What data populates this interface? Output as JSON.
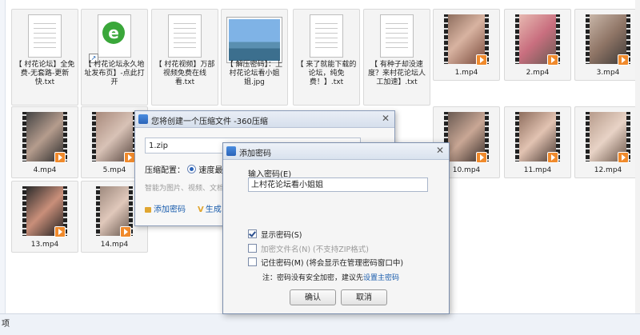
{
  "files": [
    {
      "name": "【 村花论坛】全免费-无套路-更新快.txt",
      "kind": "text"
    },
    {
      "name": "【 村花论坛永久地址发布页】-点此打开",
      "kind": "shortcut"
    },
    {
      "name": "【 村花视频】万部视频免费在线看.txt",
      "kind": "text"
    },
    {
      "name": "【 解压密码】：上村花论坛看小姐姐.jpg",
      "kind": "image"
    },
    {
      "name": "【 来了就能下载的论坛，纯免费！】.txt",
      "kind": "text"
    },
    {
      "name": "【 有种子却没速度？来村花论坛人工加速】.txt",
      "kind": "text"
    },
    {
      "name": "1.mp4",
      "kind": "video"
    },
    {
      "name": "2.mp4",
      "kind": "video"
    },
    {
      "name": "3.mp4",
      "kind": "video"
    },
    {
      "name": "4.mp4",
      "kind": "video"
    },
    {
      "name": "5.mp4",
      "kind": "video"
    },
    {
      "name": "10.mp4",
      "kind": "video"
    },
    {
      "name": "11.mp4",
      "kind": "video"
    },
    {
      "name": "12.mp4",
      "kind": "video"
    },
    {
      "name": "13.mp4",
      "kind": "video"
    },
    {
      "name": "14.mp4",
      "kind": "video"
    }
  ],
  "status_bar": {
    "text": "项"
  },
  "compress_dialog": {
    "title": "您将创建一个压缩文件 -360压缩",
    "filename": "1.zip",
    "config_label": "压缩配置：",
    "config_value": "速度最",
    "hint": "智能为图片、视频、文档",
    "add_password": "添加密码",
    "generate": "生成"
  },
  "password_dialog": {
    "title": "添加密码",
    "input_label": "输入密码(E)",
    "password_value": "上村花论坛看小姐姐",
    "show_password": "显示密码(S)",
    "encrypt_filenames": "加密文件名(N) (不支持ZIP格式)",
    "remember_password": "记住密码(M) (将会显示在管理密码窗口中)",
    "note_prefix": "注：密码没有安全加密，建议先",
    "note_link": "设置主密码",
    "ok": "确认",
    "cancel": "取消",
    "show_password_checked": true
  },
  "colors": {
    "accent": "#2a63b8",
    "link": "#1a5dad",
    "video_badge": "#f08a2c"
  }
}
